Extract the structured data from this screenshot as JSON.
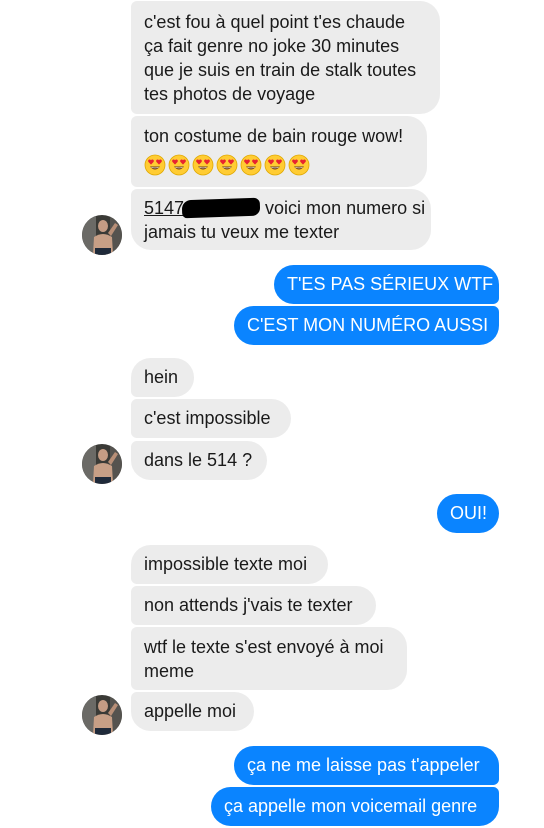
{
  "conversation": {
    "messages": [
      {
        "lines": [
          "c'est fou à quel point t'es chaude",
          "ça fait genre no joke 30 minutes",
          "que je suis en train de stalk toutes",
          "tes photos de voyage"
        ]
      },
      {
        "lines": [
          "ton costume de bain rouge wow!"
        ],
        "emoji_count": 7,
        "emoji_icon": "heart-eyes-emoji"
      },
      {
        "number_prefix": "5147",
        "text_after": " voici mon numero si",
        "line2": "jamais tu veux me texter"
      },
      {
        "text": "T'ES PAS SÉRIEUX WTF"
      },
      {
        "text": "C'EST MON NUMÉRO AUSSI"
      },
      {
        "text": "hein"
      },
      {
        "text": "c'est impossible"
      },
      {
        "text": "dans le 514 ?"
      },
      {
        "text": "OUI!"
      },
      {
        "text": "impossible texte moi"
      },
      {
        "text": "non attends j'vais te texter"
      },
      {
        "lines": [
          "wtf le texte s'est envoyé à moi",
          "meme"
        ]
      },
      {
        "text": "appelle moi"
      },
      {
        "text": "ça ne me laisse pas t'appeler"
      },
      {
        "text": "ça appelle mon voicemail genre"
      }
    ]
  },
  "colors": {
    "incoming_bubble": "#ececec",
    "outgoing_bubble": "#0a84ff"
  },
  "icons": {
    "avatar": "contact-avatar"
  }
}
